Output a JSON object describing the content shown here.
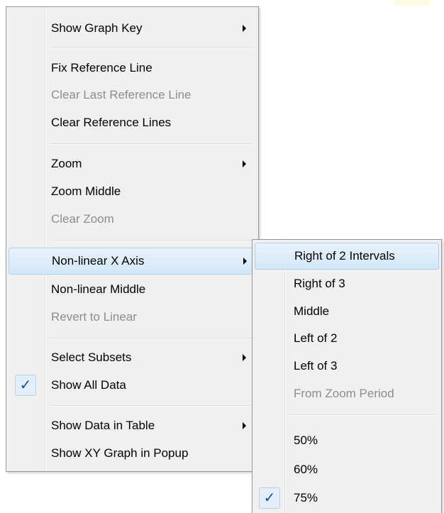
{
  "main_menu": {
    "items": [
      {
        "label": "Show Graph Key",
        "submenu": true
      },
      {
        "label": "Fix Reference Line"
      },
      {
        "label": "Clear Last Reference Line",
        "disabled": true
      },
      {
        "label": "Clear Reference Lines"
      },
      {
        "label": "Zoom",
        "submenu": true
      },
      {
        "label": "Zoom Middle"
      },
      {
        "label": "Clear Zoom",
        "disabled": true
      },
      {
        "label": "Non-linear X Axis",
        "submenu": true,
        "highlighted": true
      },
      {
        "label": "Non-linear Middle"
      },
      {
        "label": "Revert to Linear",
        "disabled": true
      },
      {
        "label": "Select Subsets",
        "submenu": true
      },
      {
        "label": "Show All Data",
        "checked": true
      },
      {
        "label": "Show Data in Table",
        "submenu": true
      },
      {
        "label": "Show XY Graph in Popup"
      }
    ]
  },
  "submenu": {
    "items": [
      {
        "label": "Right of 2 Intervals",
        "highlighted": true
      },
      {
        "label": "Right of 3"
      },
      {
        "label": "Middle"
      },
      {
        "label": "Left of 2"
      },
      {
        "label": "Left of 3"
      },
      {
        "label": "From Zoom Period",
        "disabled": true
      },
      {
        "label": "50%"
      },
      {
        "label": "60%"
      },
      {
        "label": "75%",
        "checked": true
      }
    ]
  },
  "check_glyph": "✓",
  "colors": {
    "menu_bg": "#f0f0f0",
    "highlight": "#d3e7f8",
    "disabled_text": "#8d8d8d",
    "check": "#1b4f99"
  }
}
